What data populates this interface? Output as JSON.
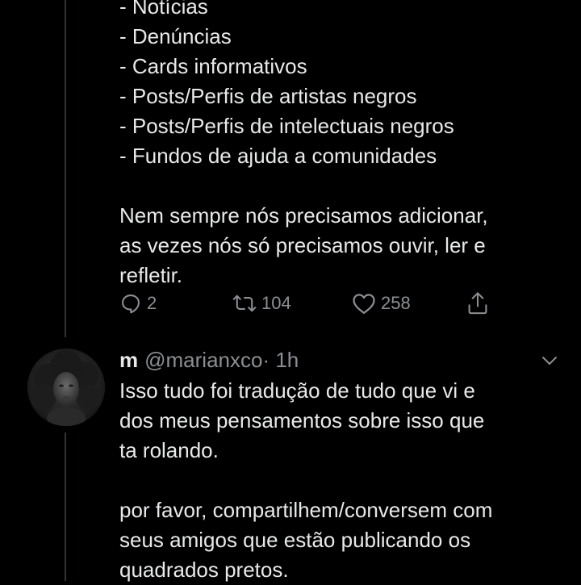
{
  "tweet1": {
    "list_items": [
      "- Notícias",
      "- Denúncias",
      "- Cards informativos",
      "- Posts/Perfis de artistas negros",
      "- Posts/Perfis de intelectuais negros",
      "- Fundos de ajuda a comunidades"
    ],
    "paragraph_lines": [
      "Nem sempre nós precisamos adicionar,",
      "as vezes nós só precisamos ouvir, ler e",
      "refletir."
    ],
    "actions": {
      "reply_count": "2",
      "retweet_count": "104",
      "like_count": "258",
      "reply_icon": "reply-icon",
      "retweet_icon": "retweet-icon",
      "like_icon": "heart-icon",
      "share_icon": "share-icon"
    }
  },
  "tweet2": {
    "display_name": "m",
    "handle": "@marianxco",
    "separator_time": "· 1h",
    "lines_para1": [
      "Isso tudo foi tradução de tudo que vi e",
      "dos meus pensamentos sobre isso que",
      "ta rolando."
    ],
    "lines_para2": [
      "por favor, compartilhem/conversem com",
      "seus amigos que estão publicando os",
      "quadrados pretos."
    ],
    "menu_icon": "chevron-down-icon"
  },
  "colors": {
    "background": "#000000",
    "text_primary": "#e7e9ea",
    "text_secondary": "#8b8f93",
    "thread_line": "#2f3336"
  }
}
